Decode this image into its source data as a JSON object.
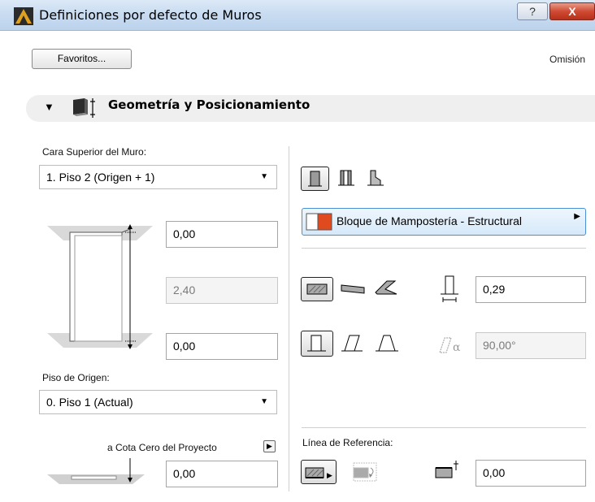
{
  "window": {
    "title": "Definiciones por defecto de Muros",
    "help_label": "?",
    "close_label": "X"
  },
  "toolbar": {
    "favorites_label": "Favoritos...",
    "default_label": "Omisión"
  },
  "section": {
    "title": "Geometría y Posicionamiento"
  },
  "top_of_wall": {
    "label": "Cara Superior del Muro:",
    "selected": "1. Piso 2 (Origen + 1)"
  },
  "offsets": {
    "top_offset": "0,00",
    "height": "2,40",
    "bottom_offset": "0,00"
  },
  "home_story": {
    "label": "Piso de Origen:",
    "selected": "0. Piso 1 (Actual)"
  },
  "project_zero": {
    "label": "a Cota Cero del Proyecto",
    "value": "0,00"
  },
  "material": {
    "label": "Bloque de Mampostería - Estructural",
    "colors": [
      "#e04a1f",
      "#ffffff"
    ]
  },
  "thickness": {
    "value": "0,29"
  },
  "angle": {
    "value": "90,00°"
  },
  "reference_line": {
    "label": "Línea de Referencia:",
    "offset_value": "0,00"
  },
  "colors": {
    "titlebar": "#c9dcf1",
    "close": "#c9432c",
    "accent_blue": "#4d8fd4"
  }
}
